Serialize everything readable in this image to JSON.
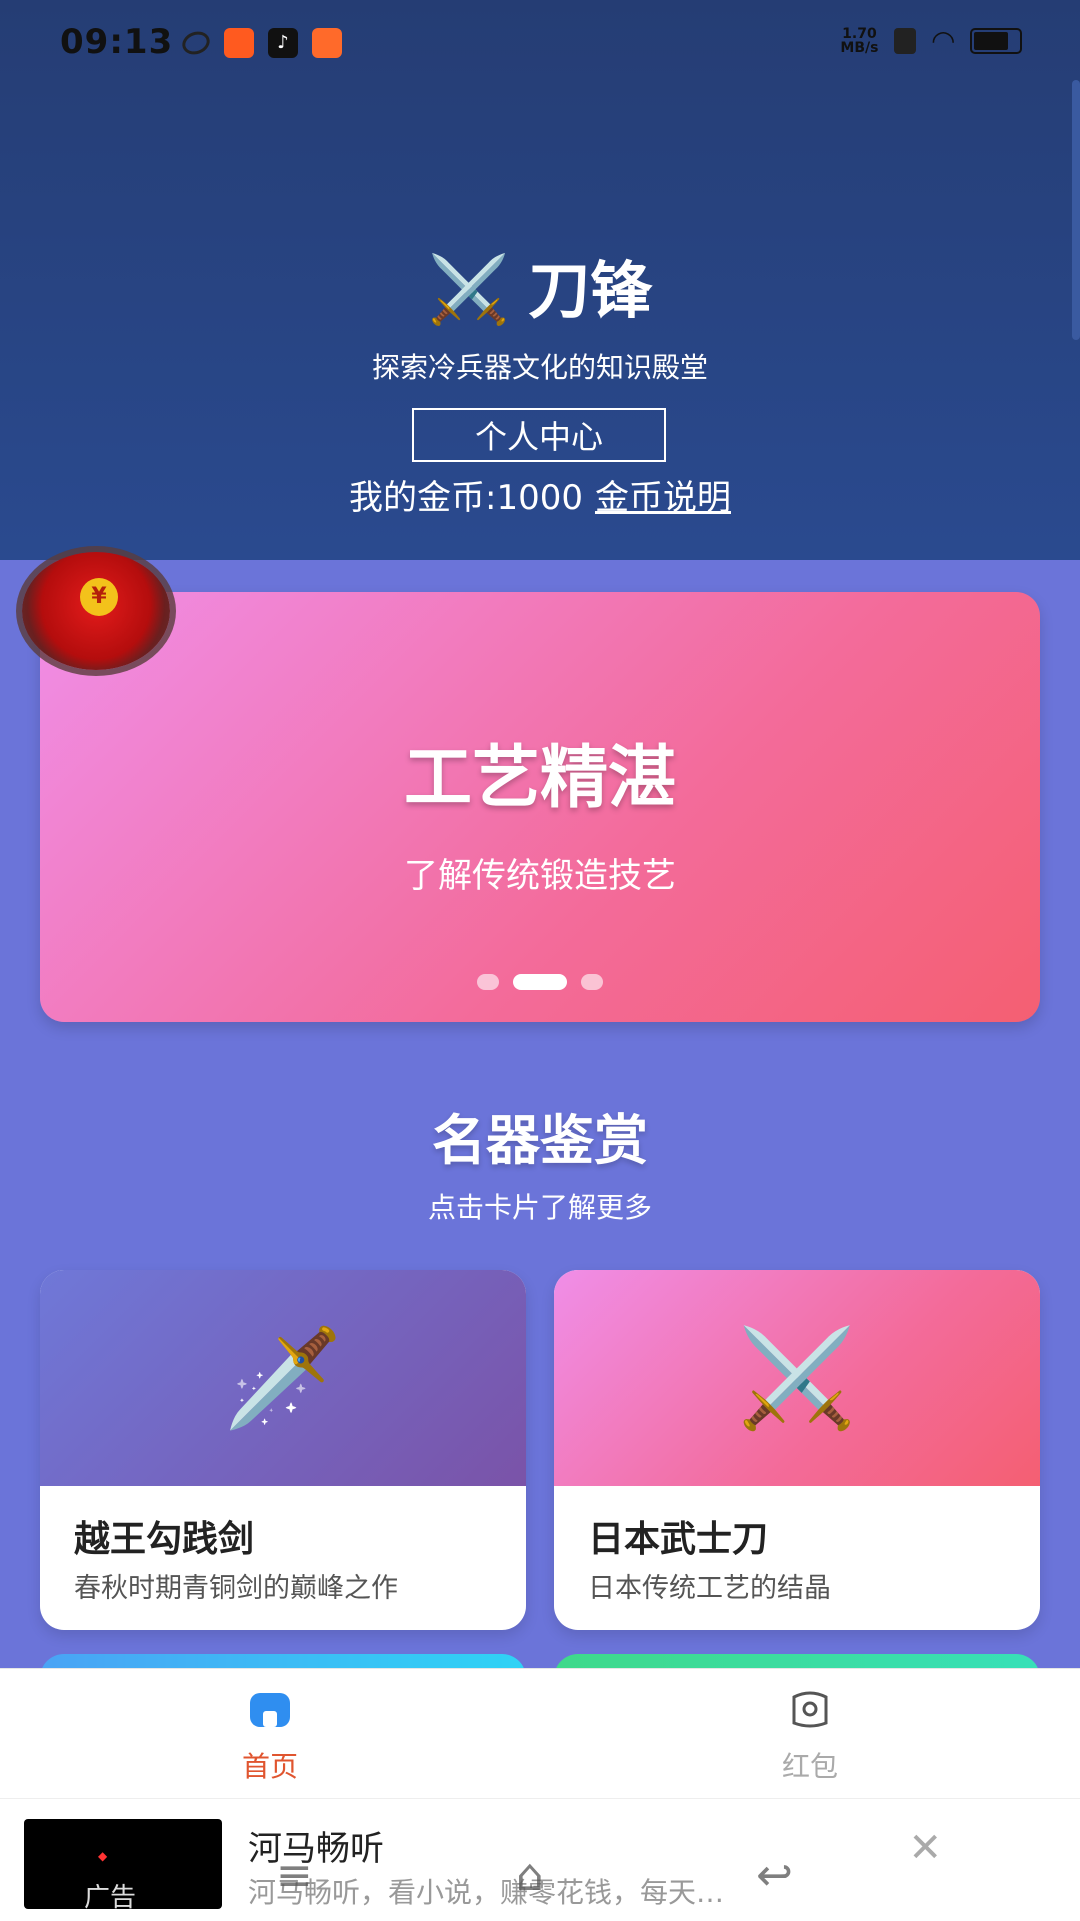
{
  "status": {
    "time": "09:13",
    "speed": "1.70\nMB/s"
  },
  "header": {
    "brand_icon": "⚔️",
    "brand_name": "刀锋",
    "slogan": "探索冷兵器文化的知识殿堂",
    "profile_button": "个人中心",
    "coins_label": "我的金币:1000",
    "coins_help_link": "金币说明"
  },
  "redpacket": {
    "symbol": "¥"
  },
  "banner": {
    "title": "工艺精湛",
    "subtitle": "了解传统锻造技艺",
    "slide_count": 3,
    "active_slide": 2
  },
  "section": {
    "title": "名器鉴赏",
    "subtitle": "点击卡片了解更多"
  },
  "cards": [
    {
      "icon": "🗡️",
      "name": "越王勾践剑",
      "desc": "春秋时期青铜剑的巅峰之作"
    },
    {
      "icon": "⚔️",
      "name": "日本武士刀",
      "desc": "日本传统工艺的结晶"
    }
  ],
  "tabbar": [
    {
      "label": "首页",
      "active": true
    },
    {
      "label": "红包",
      "active": false
    }
  ],
  "ad": {
    "thumb_label": "广告",
    "title": "河马畅听",
    "desc": "河马畅听，看小说，赚零花钱，每天…",
    "close": "✕"
  },
  "colors": {
    "header_bg": "#253d74",
    "page_bg": "#6b74d9",
    "active_tab": "#e0552f"
  }
}
